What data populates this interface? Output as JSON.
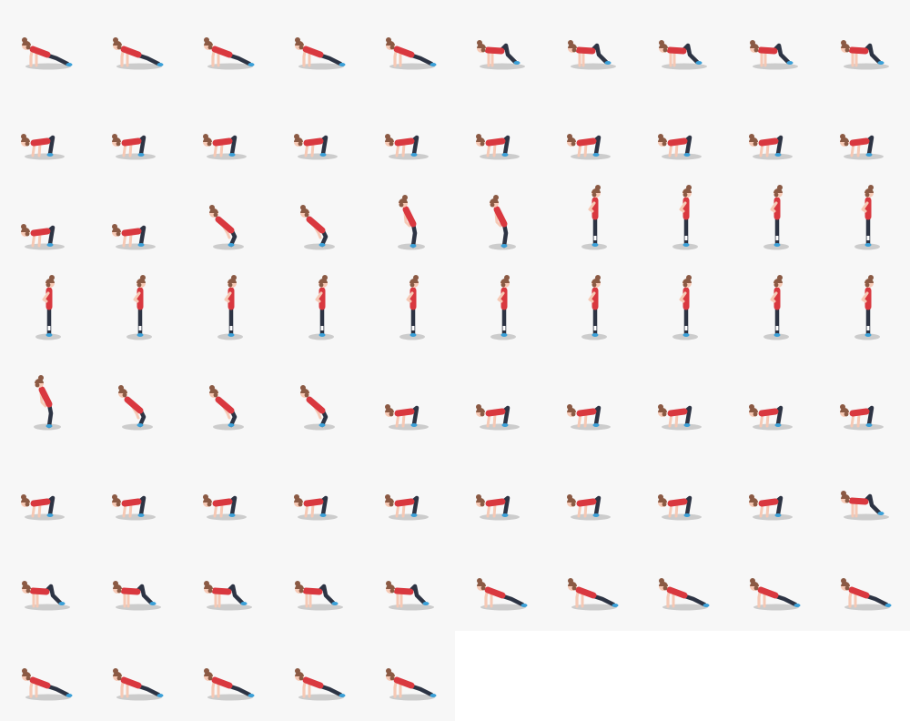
{
  "sprite_sheet": {
    "columns": 10,
    "frame_count": 75,
    "background_color": "#f7f7f7",
    "empty_color": "#ffffff",
    "colors": {
      "hair": "#8b5a44",
      "skin": "#f6c9b5",
      "top": "#d9383f",
      "pants": "#2d3444",
      "shoe": "#3ba0d8",
      "sock": "#ffffff",
      "shadow": "#cccccc"
    },
    "sequence": [
      {
        "pose": "plank",
        "count": 5
      },
      {
        "pose": "jump-in",
        "count": 5
      },
      {
        "pose": "squat",
        "count": 12
      },
      {
        "pose": "rise",
        "count": 2
      },
      {
        "pose": "half-stand",
        "count": 2
      },
      {
        "pose": "stand",
        "count": 14
      },
      {
        "pose": "half-stand",
        "count": 1
      },
      {
        "pose": "rise",
        "count": 3
      },
      {
        "pose": "squat",
        "count": 15
      },
      {
        "pose": "jump-in",
        "count": 6
      },
      {
        "pose": "plank",
        "count": 10
      }
    ]
  }
}
